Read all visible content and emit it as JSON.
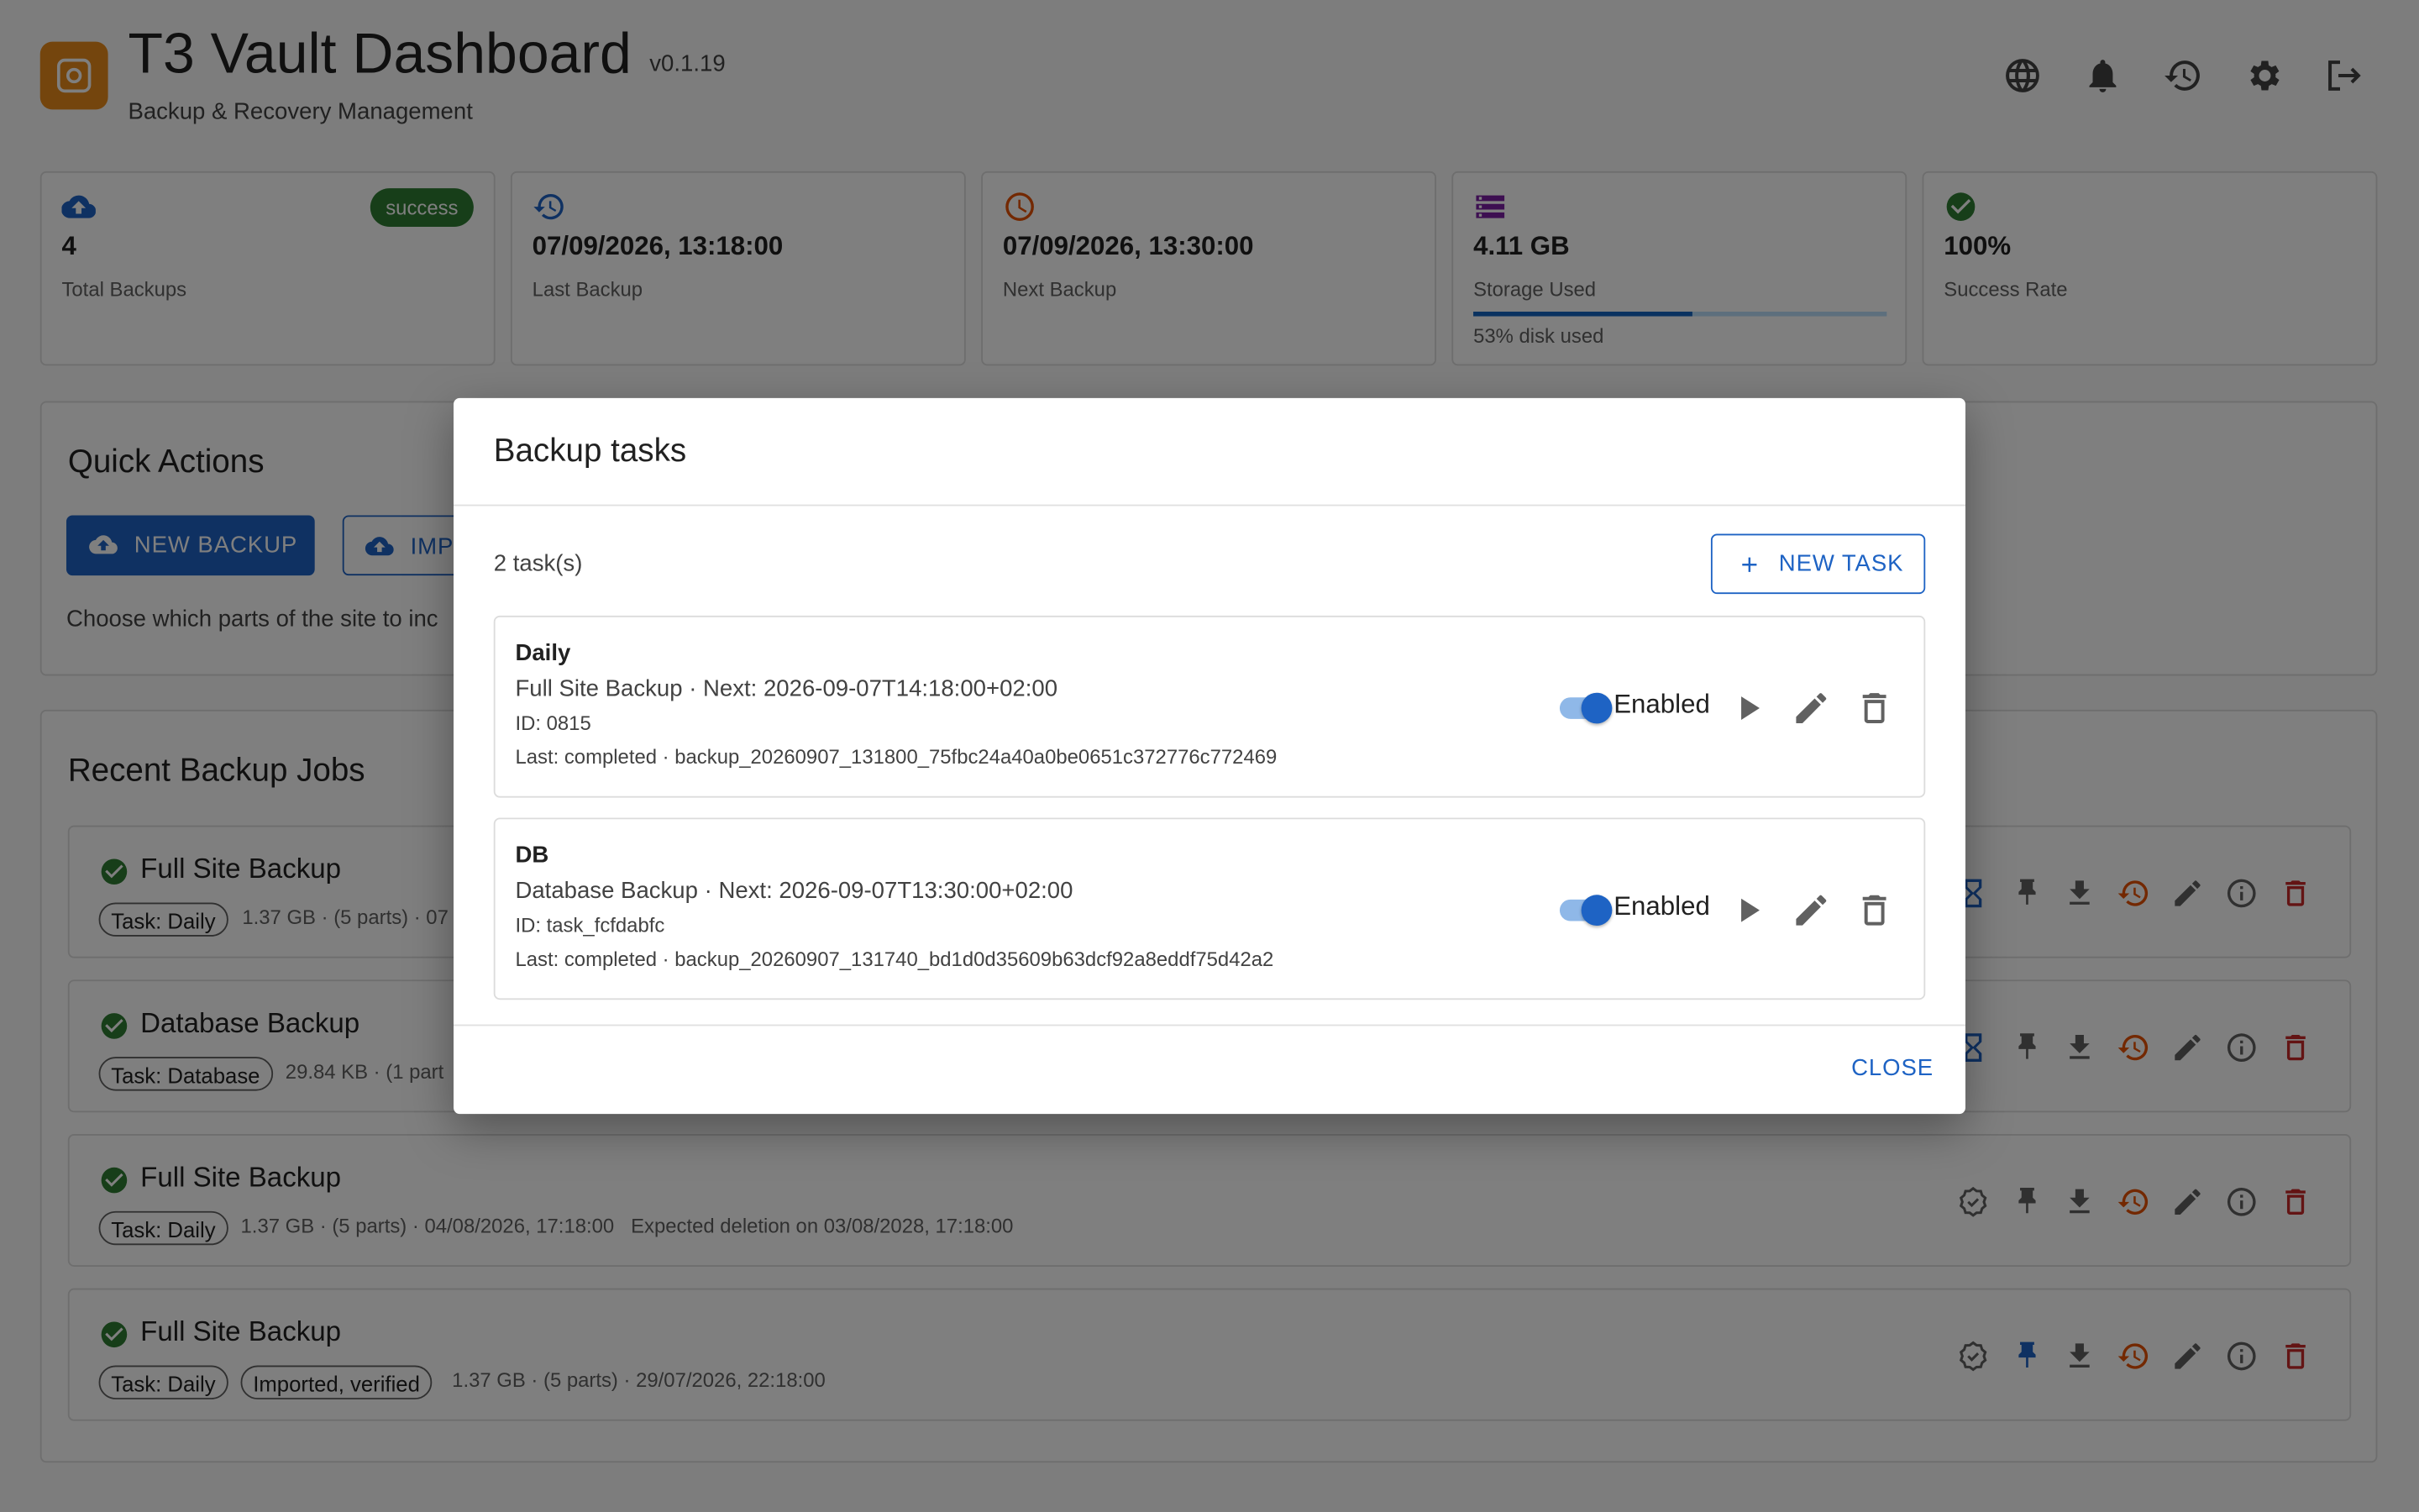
{
  "header": {
    "title": "T3 Vault Dashboard",
    "version": "v0.1.19",
    "subtitle": "Backup & Recovery Management",
    "icons": [
      "language-icon",
      "bell-icon",
      "history-icon",
      "settings-icon",
      "logout-icon"
    ]
  },
  "stats": {
    "total": {
      "value": "4",
      "label": "Total Backups",
      "badge": "success"
    },
    "last": {
      "value": "07/09/2026, 13:18:00",
      "label": "Last Backup"
    },
    "next": {
      "value": "07/09/2026, 13:30:00",
      "label": "Next Backup"
    },
    "storage": {
      "value": "4.11 GB",
      "label": "Storage Used",
      "disk_fraction": 0.53,
      "disk_text": "53% disk used"
    },
    "success": {
      "value": "100%",
      "label": "Success Rate"
    }
  },
  "quick_actions": {
    "title": "Quick Actions",
    "new_backup": "NEW BACKUP",
    "import": "IMP",
    "helper": "Choose which parts of the site to inc"
  },
  "jobs": {
    "title": "Recent Backup Jobs",
    "items": [
      {
        "title": "Full Site Backup",
        "chips": [
          "Task: Daily"
        ],
        "meta": "1.37 GB · (5 parts) · 07"
      },
      {
        "title": "Database Backup",
        "chips": [
          "Task: Database"
        ],
        "meta": "29.84 KB · (1 part"
      },
      {
        "title": "Full Site Backup",
        "chips": [
          "Task: Daily"
        ],
        "meta": "1.37 GB · (5 parts) · 04/08/2026, 17:18:00   Expected deletion on 03/08/2028, 17:18:00"
      },
      {
        "title": "Full Site Backup",
        "chips": [
          "Task: Daily",
          "Imported, verified"
        ],
        "meta": "1.37 GB · (5 parts) · 29/07/2026, 22:18:00"
      }
    ]
  },
  "dialog": {
    "title": "Backup tasks",
    "count": "2 task(s)",
    "new_task": "NEW TASK",
    "close": "CLOSE",
    "tasks": [
      {
        "name": "Daily",
        "desc": "Full Site Backup · Next: 2026-09-07T14:18:00+02:00",
        "id": "ID: 0815",
        "last": "Last: completed · backup_20260907_131800_75fbc24a40a0be0651c372776c772469",
        "enabled_label": "Enabled",
        "enabled": true
      },
      {
        "name": "DB",
        "desc": "Database Backup · Next: 2026-09-07T13:30:00+02:00",
        "id": "ID: task_fcfdabfc",
        "last": "Last: completed · backup_20260907_131740_bd1d0d35609b63dcf92a8eddf75d42a2",
        "enabled_label": "Enabled",
        "enabled": true
      }
    ]
  },
  "colors": {
    "primary": "#1e63c4",
    "success": "#2e7d32",
    "danger": "#c62828",
    "restore": "#e65100",
    "logo": "#e88a1a",
    "storage_icon": "#7b1fa2"
  }
}
